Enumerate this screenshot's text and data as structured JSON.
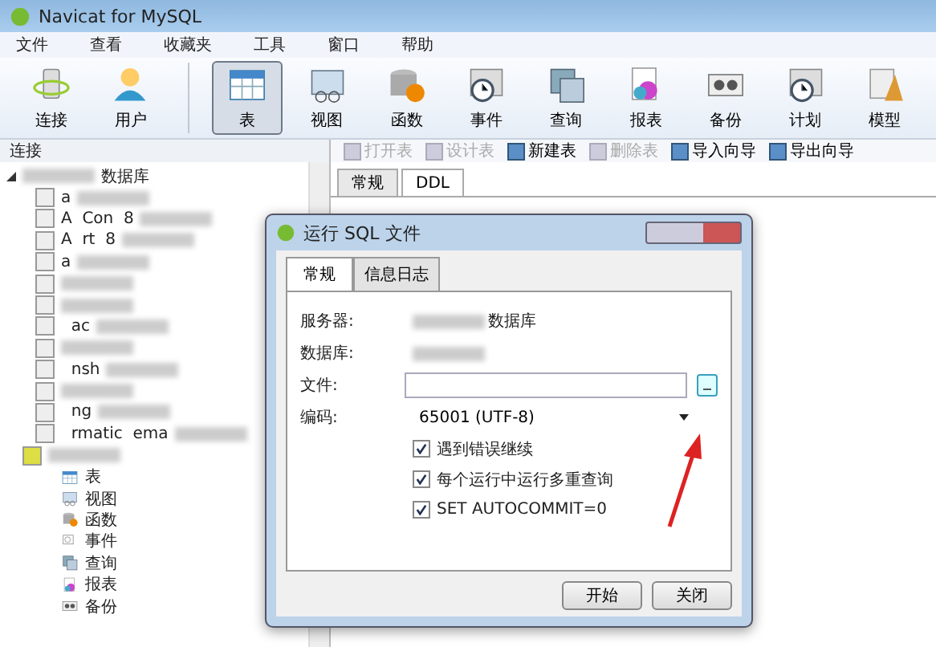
{
  "window": {
    "title": "Navicat for MySQL"
  },
  "menu": [
    "文件",
    "查看",
    "收藏夹",
    "工具",
    "窗口",
    "帮助"
  ],
  "toolbar": [
    {
      "label": "连接",
      "kind": "plug",
      "selected": false
    },
    {
      "label": "用户",
      "kind": "user",
      "selected": false
    },
    {
      "label": "表",
      "kind": "table",
      "selected": true
    },
    {
      "label": "视图",
      "kind": "view",
      "selected": false
    },
    {
      "label": "函数",
      "kind": "func",
      "selected": false
    },
    {
      "label": "事件",
      "kind": "clock",
      "selected": false
    },
    {
      "label": "查询",
      "kind": "query",
      "selected": false
    },
    {
      "label": "报表",
      "kind": "report",
      "selected": false
    },
    {
      "label": "备份",
      "kind": "backup",
      "selected": false
    },
    {
      "label": "计划",
      "kind": "clock",
      "selected": false
    },
    {
      "label": "模型",
      "kind": "model",
      "selected": false
    }
  ],
  "connection_header": "连接",
  "object_toolbar": [
    {
      "label": "打开表",
      "disabled": true
    },
    {
      "label": "设计表",
      "disabled": true
    },
    {
      "label": "新建表",
      "disabled": false
    },
    {
      "label": "删除表",
      "disabled": true
    },
    {
      "label": "导入向导",
      "disabled": false
    },
    {
      "label": "导出向导",
      "disabled": false
    }
  ],
  "object_tabs": [
    {
      "label": "常规",
      "selected": false
    },
    {
      "label": "DDL",
      "selected": true
    }
  ],
  "tree": {
    "root_suffix": "数据库",
    "databases": [
      {
        "label": "a",
        "redacted": true
      },
      {
        "label": "A  Con  8",
        "redacted": true
      },
      {
        "label": "A  rt  8",
        "redacted": true
      },
      {
        "label": "a",
        "redacted": true
      },
      {
        "redacted": true
      },
      {
        "redacted": true
      },
      {
        "label": "  ac",
        "redacted": true
      },
      {
        "redacted": true
      },
      {
        "label": "  nsh",
        "redacted": true
      },
      {
        "redacted": true
      },
      {
        "label": "  ng",
        "redacted": true
      },
      {
        "label": "  rmatic  ema",
        "redacted": true
      }
    ],
    "open_db": {
      "children": [
        {
          "label": "表",
          "kind": "table"
        },
        {
          "label": "视图",
          "kind": "view"
        },
        {
          "label": "函数",
          "kind": "func"
        },
        {
          "label": "事件",
          "kind": "event"
        },
        {
          "label": "查询",
          "kind": "query"
        },
        {
          "label": "报表",
          "kind": "report"
        },
        {
          "label": "备份",
          "kind": "backup"
        }
      ]
    }
  },
  "dialog": {
    "title": "运行 SQL 文件",
    "tabs": [
      {
        "label": "常规",
        "selected": true
      },
      {
        "label": "信息日志",
        "selected": false
      }
    ],
    "fields": [
      {
        "label": "服务器:",
        "kind": "text",
        "value": "数据库"
      },
      {
        "label": "数据库:",
        "kind": "text"
      },
      {
        "label": "文件:",
        "kind": "file"
      },
      {
        "label": "编码:",
        "kind": "select",
        "value": "65001 (UTF-8)"
      }
    ],
    "options": [
      {
        "label": "遇到错误继续",
        "checked": true
      },
      {
        "label": "每个运行中运行多重查询",
        "checked": true
      },
      {
        "label": "SET AUTOCOMMIT=0",
        "checked": true
      }
    ],
    "buttons": [
      "开始",
      "关闭"
    ]
  }
}
